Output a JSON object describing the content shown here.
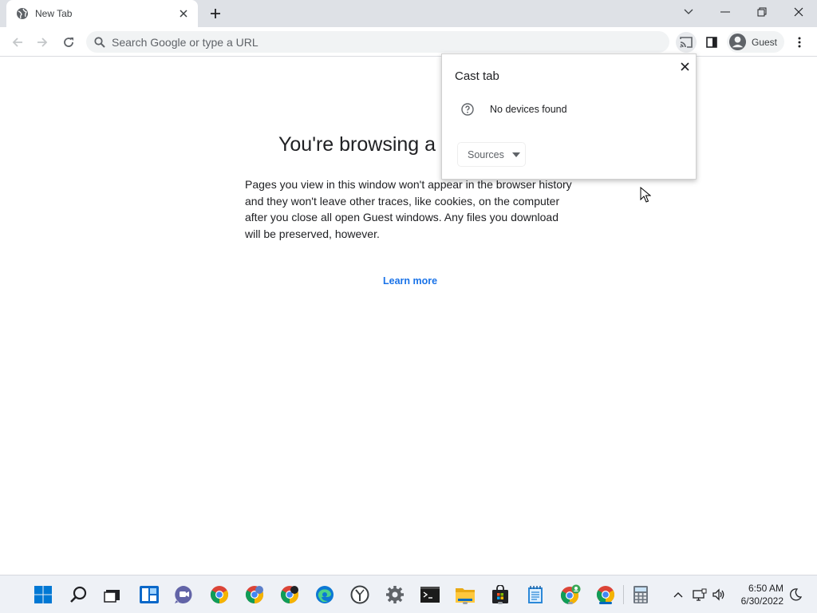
{
  "browser": {
    "tab": {
      "title": "New Tab"
    },
    "omnibox": {
      "placeholder": "Search Google or type a URL"
    },
    "profile": {
      "label": "Guest"
    }
  },
  "page": {
    "title": "You're browsing a",
    "body": "Pages you view in this window won't appear in the browser history and they won't leave other traces, like cookies, on the computer after you close all open Guest windows. Any files you download will be preserved, however.",
    "learn_more": "Learn more",
    "link_color": "#1a73e8"
  },
  "cast_dialog": {
    "title": "Cast tab",
    "no_devices": "No devices found",
    "sources_label": "Sources"
  },
  "taskbar": {
    "apps": [
      "start-icon",
      "search-icon",
      "task-view-icon",
      "widgets-icon",
      "teams-chat-icon",
      "chrome-icon",
      "chrome-profile-icon",
      "chrome-profile-icon",
      "edge-icon",
      "clock-app-icon",
      "settings-icon",
      "terminal-icon",
      "file-explorer-icon",
      "store-icon",
      "notepad-icon",
      "chrome-guest-icon",
      "chrome-active-icon",
      "calculator-icon"
    ],
    "tray": [
      "chevron-up-icon",
      "network-icon",
      "volume-icon",
      "night-mode-icon"
    ],
    "time": "6:50 AM",
    "date": "6/30/2022",
    "accent": "#0067c0"
  }
}
